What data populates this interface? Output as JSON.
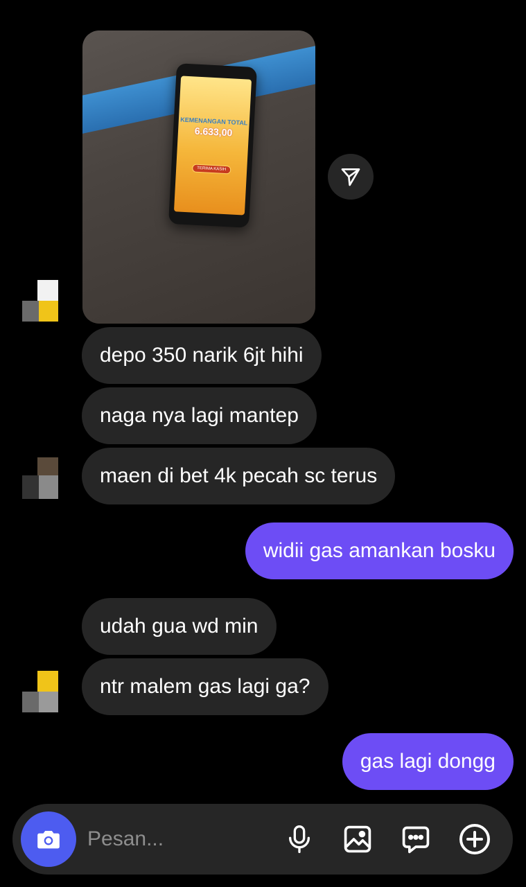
{
  "thread": {
    "photo": {
      "screen_title": "KEMENANGAN TOTAL",
      "screen_amount": "6.633,00",
      "screen_button": "TERIMA KASIH"
    },
    "messages": [
      {
        "from": "them",
        "text": "depo 350 narik 6jt hihi"
      },
      {
        "from": "them",
        "text": "naga nya lagi mantep"
      },
      {
        "from": "them",
        "text": "maen di bet 4k pecah sc terus"
      },
      {
        "from": "me",
        "text": "widii gas amankan bosku"
      },
      {
        "from": "them",
        "text": "udah gua wd min"
      },
      {
        "from": "them",
        "text": "ntr malem gas lagi ga?"
      },
      {
        "from": "me",
        "text": "gas lagi dongg"
      }
    ]
  },
  "composer": {
    "placeholder": "Pesan...",
    "icons": [
      "camera-icon",
      "microphone-icon",
      "gallery-icon",
      "sticker-chat-icon",
      "plus-circle-icon"
    ]
  },
  "colors": {
    "background": "#000000",
    "incoming_bubble": "#262626",
    "outgoing_bubble": "#6d4df5",
    "camera_button": "#4d5cf0"
  }
}
